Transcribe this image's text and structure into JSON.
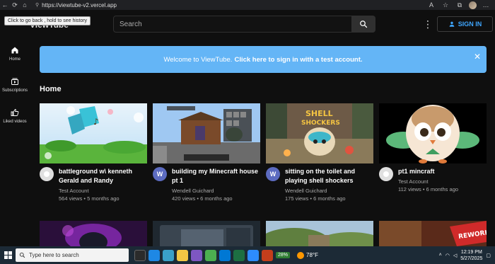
{
  "browser": {
    "url": "https://viewtube-v2.vercel.app",
    "tooltip": "Click to go back , hold to see history"
  },
  "header": {
    "logo": "ViewTube",
    "search_placeholder": "Search",
    "signin_label": "SIGN IN"
  },
  "sidebar": {
    "items": [
      {
        "label": "Home",
        "icon": "home-icon"
      },
      {
        "label": "Subscriptions",
        "icon": "subscriptions-icon"
      },
      {
        "label": "Liked videos",
        "icon": "thumbs-up-icon"
      }
    ]
  },
  "banner": {
    "text": "Welcome to ViewTube.",
    "link": "Click here to sign in with a test account.",
    "close": "✕"
  },
  "section": {
    "title": "Home"
  },
  "videos": [
    {
      "title": "battleground w\\ kenneth Gerald and Randy",
      "channel": "Test Account",
      "stats": "564 views • 5 months ago",
      "avatar": "",
      "avatar_style": "grey"
    },
    {
      "title": "building my Minecraft house pt 1",
      "channel": "Wendell Guichard",
      "stats": "420 views • 6 months ago",
      "avatar": "W",
      "avatar_style": "purple"
    },
    {
      "title": "sitting on the toilet and playing shell shockers",
      "channel": "Wendell Guichard",
      "stats": "175 views • 6 months ago",
      "avatar": "W",
      "avatar_style": "purple"
    },
    {
      "title": "pt1 mincraft",
      "channel": "Test Account",
      "stats": "112 views • 6 months ago",
      "avatar": "",
      "avatar_style": "grey"
    }
  ],
  "taskbar": {
    "search_placeholder": "Type here to search",
    "battery": "28%",
    "weather": "78°F",
    "time": "12:19 PM",
    "date": "5/27/2025"
  },
  "colors": {
    "background": "#0f0f0f",
    "banner": "#64b5f6",
    "accent": "#3ea6ff",
    "avatar_purple": "#5c6bc0"
  }
}
